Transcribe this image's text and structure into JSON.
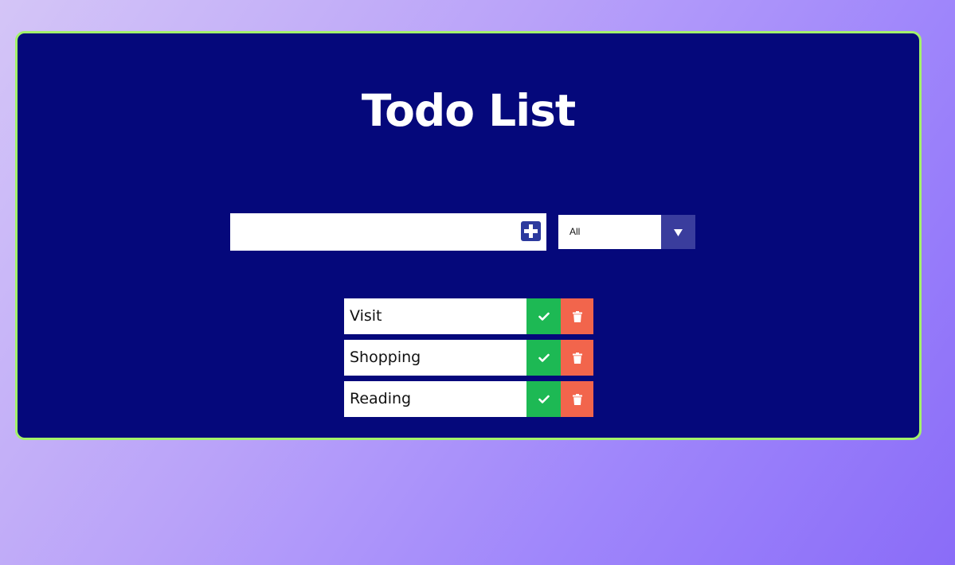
{
  "header": {
    "title": "Todo List"
  },
  "add_form": {
    "input_value": "",
    "input_placeholder": "",
    "add_icon": "plus-square-icon"
  },
  "filter": {
    "selected": "All",
    "arrow_icon": "triangle-down-icon"
  },
  "todos": [
    {
      "text": "Visit"
    },
    {
      "text": "Shopping"
    },
    {
      "text": "Reading"
    }
  ],
  "icons": {
    "complete": "check-icon",
    "delete": "trash-icon"
  },
  "colors": {
    "panel": "#05087b",
    "panel_border": "#a3f26a",
    "complete": "#1db954",
    "delete": "#f2654c",
    "accent": "#3a3d9d"
  }
}
